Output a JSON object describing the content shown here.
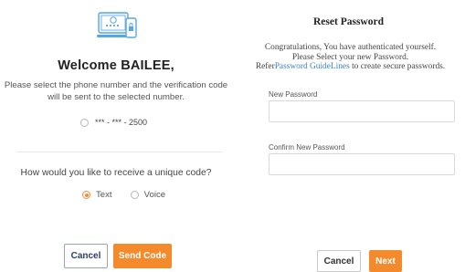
{
  "left": {
    "welcome": "Welcome  BAILEE,",
    "instruction": "Please select the phone number and the verification code will be sent to the selected number.",
    "phone_option": "*** - *** - 2500",
    "phone_selected": false,
    "question": "How would you like to receive a unique code?",
    "methods": [
      {
        "label": "Text",
        "selected": true
      },
      {
        "label": "Voice",
        "selected": false
      }
    ],
    "cancel_label": "Cancel",
    "send_label": "Send Code"
  },
  "right": {
    "title": "Reset Password",
    "line1": "Congratulations, You have authenticated yourself.",
    "line2": "Please Select your new Password.",
    "line3_prefix": "Refer",
    "line3_link": "Password GuideLines",
    "line3_suffix": " to create secure passwords.",
    "new_password_label": "New Password",
    "new_password_value": "",
    "confirm_password_label": "Confirm New Password",
    "confirm_password_value": "",
    "cancel_label": "Cancel",
    "next_label": "Next"
  },
  "colors": {
    "accent": "#f58a2c",
    "link": "#3d7fc6",
    "icon_blue": "#5aa7df"
  },
  "icons": {
    "header": "phone-lock-icon"
  }
}
